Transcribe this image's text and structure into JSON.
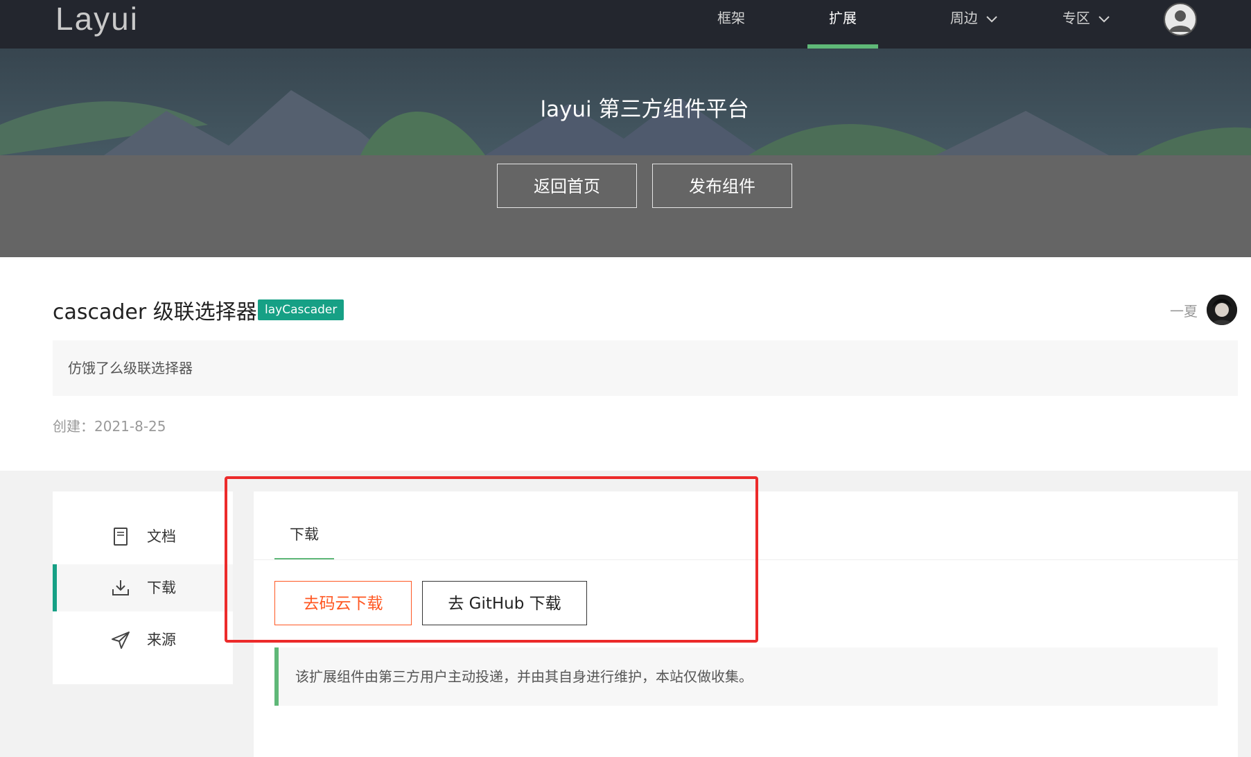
{
  "header": {
    "logo": "Layui",
    "nav": [
      {
        "label": "框架",
        "active": false,
        "dropdown": false
      },
      {
        "label": "扩展",
        "active": true,
        "dropdown": false
      },
      {
        "label": "周边",
        "active": false,
        "dropdown": true
      },
      {
        "label": "专区",
        "active": false,
        "dropdown": true
      }
    ],
    "avatar_icon": "user-avatar-icon"
  },
  "banner": {
    "title": "layui 第三方组件平台",
    "buttons": [
      "返回首页",
      "发布组件"
    ]
  },
  "component": {
    "name": "cascader 级联选择器",
    "tag": "layCascader",
    "author": "一夏",
    "description": "仿饿了么级联选择器",
    "created": "创建：2021-8-25"
  },
  "sidebar": {
    "items": [
      {
        "label": "文档",
        "icon": "document-icon",
        "active": false
      },
      {
        "label": "下载",
        "icon": "download-icon",
        "active": true
      },
      {
        "label": "来源",
        "icon": "send-icon",
        "active": false
      }
    ]
  },
  "panel": {
    "tab": "下载",
    "gitee_button": "去码云下载",
    "github_button": "去 GitHub 下载",
    "notice": "该扩展组件由第三方用户主动投递，并由其自身进行维护，本站仅做收集。"
  },
  "colors": {
    "header_bg": "#23262e",
    "accent_green": "#5fb878",
    "tag_teal": "#16a085",
    "orange": "#ff5722",
    "highlight_red": "#ec2b2b"
  }
}
